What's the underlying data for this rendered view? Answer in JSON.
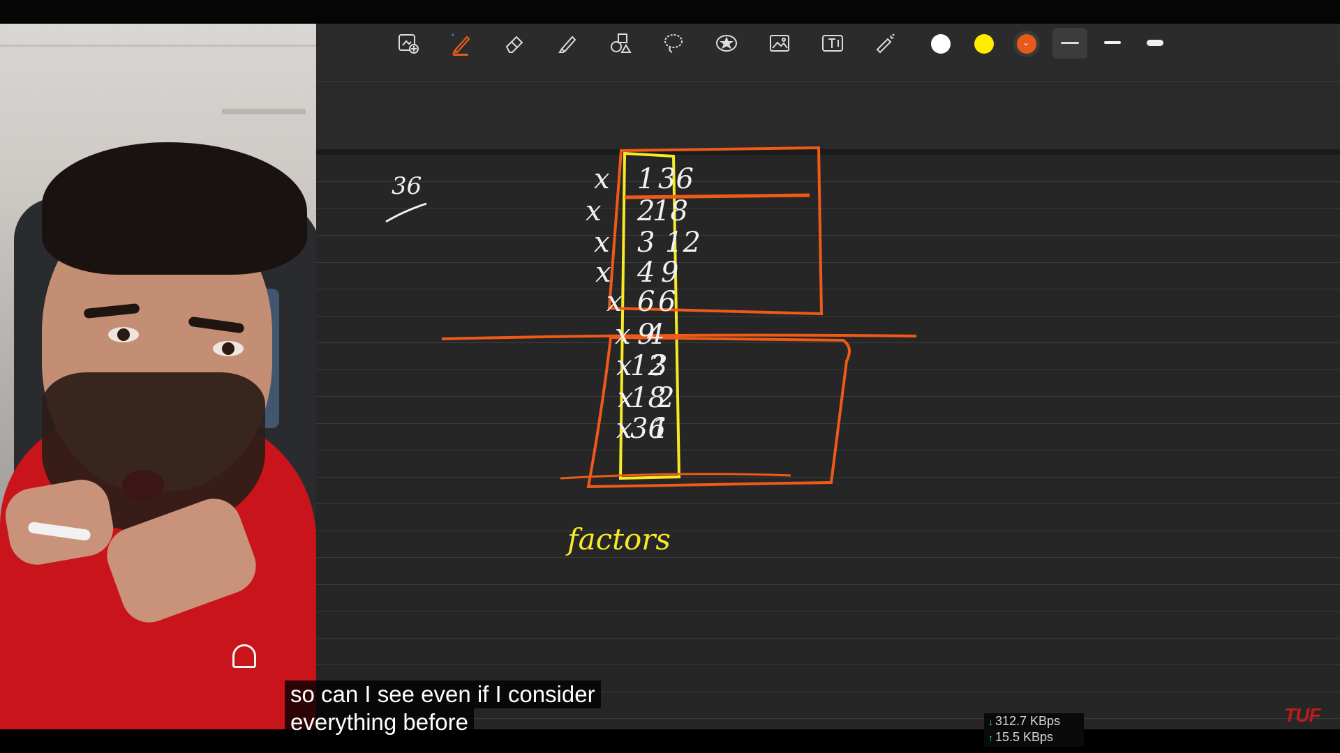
{
  "toolbar": {
    "tools": [
      {
        "name": "add-page-icon"
      },
      {
        "name": "pen-icon",
        "active": true
      },
      {
        "name": "eraser-icon"
      },
      {
        "name": "highlighter-icon"
      },
      {
        "name": "shapes-icon"
      },
      {
        "name": "lasso-icon"
      },
      {
        "name": "sticker-icon"
      },
      {
        "name": "image-icon"
      },
      {
        "name": "text-icon"
      },
      {
        "name": "laser-pointer-icon"
      }
    ],
    "colors": [
      "#ffffff",
      "#ffec00",
      "#e95a1a"
    ],
    "selected_color": "#e95a1a",
    "stroke_widths": [
      "thin",
      "medium",
      "thick"
    ],
    "selected_stroke": "thin"
  },
  "canvas": {
    "number_label": "36",
    "factor_pairs": [
      {
        "left": "1",
        "op": "x",
        "right": "36"
      },
      {
        "left": "2",
        "op": "x",
        "right": "18"
      },
      {
        "left": "3",
        "op": "x",
        "right": "12"
      },
      {
        "left": "4",
        "op": "x",
        "right": "9"
      },
      {
        "left": "6",
        "op": "x",
        "right": "6"
      },
      {
        "left": "9",
        "op": "x",
        "right": "4"
      },
      {
        "left": "12",
        "op": "x",
        "right": "3"
      },
      {
        "left": "18",
        "op": "x",
        "right": "2"
      },
      {
        "left": "36",
        "op": "x",
        "right": "1"
      }
    ],
    "annotation": "factors",
    "ink_white": "#f2f2f2",
    "ink_yellow": "#f7ea25",
    "ink_orange": "#ef5a18"
  },
  "subtitles": {
    "line1": "so can I see even if I consider",
    "line2": "everything before"
  },
  "network": {
    "download": "312.7 KBps",
    "upload": "15.5 KBps"
  },
  "brand": "TUF"
}
